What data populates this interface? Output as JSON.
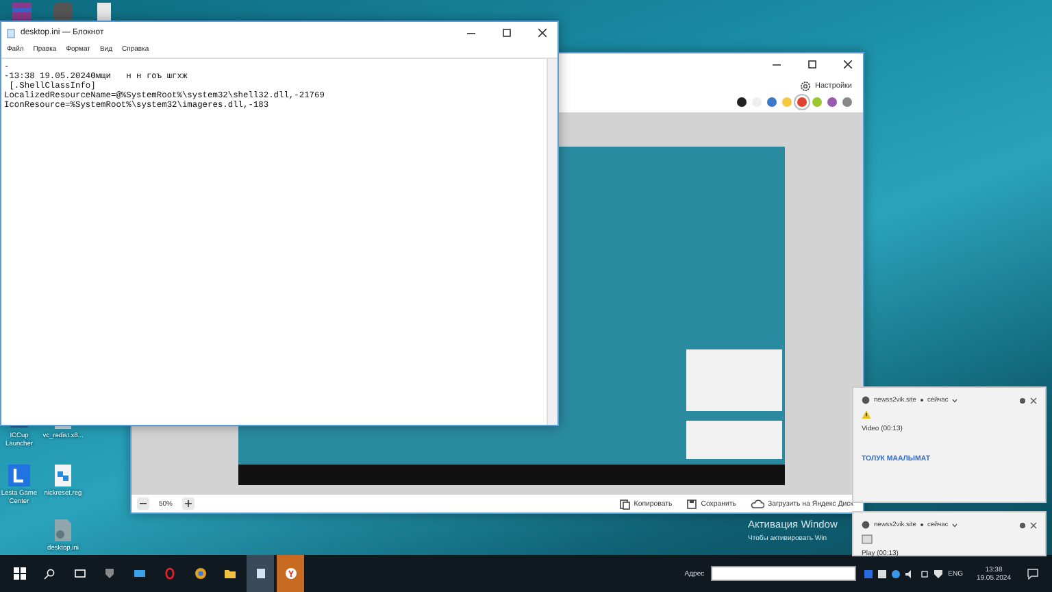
{
  "desktop": {
    "icons": [
      {
        "label": "ICCup Launcher",
        "kind": "app"
      },
      {
        "label": "vc_redist.x8...",
        "kind": "file"
      },
      {
        "label": "Lesta Game Center",
        "kind": "shortcut"
      },
      {
        "label": "nickreset.reg",
        "kind": "reg"
      },
      {
        "label": "desktop.ini",
        "kind": "ini"
      }
    ]
  },
  "notepad": {
    "title": "desktop.ini — Блокнот",
    "menu": [
      "Файл",
      "Правка",
      "Формат",
      "Вид",
      "Справка"
    ],
    "lines": [
      "-",
      "-13:38 19.05.2024Өмщи   н н гоъ шгхж",
      " [.ShellClassInfo]",
      "LocalizedResourceName=@%SystemRoot%\\system32\\shell32.dll,-21769",
      "IconResource=%SystemRoot%\\system32\\imageres.dll,-183"
    ]
  },
  "editor": {
    "settings": "Настройки",
    "colors": [
      {
        "color": "#222222",
        "selected": false
      },
      {
        "color": "#eeeeee",
        "selected": false
      },
      {
        "color": "#3a78c8",
        "selected": false
      },
      {
        "color": "#f5c842",
        "selected": false
      },
      {
        "color": "#e04030",
        "selected": true
      },
      {
        "color": "#9ac830",
        "selected": false
      },
      {
        "color": "#9a5ab0",
        "selected": false
      },
      {
        "color": "#888888",
        "selected": false
      }
    ],
    "zoom": "50%",
    "actions": [
      {
        "kind": "copy",
        "label": "Копировать"
      },
      {
        "kind": "save",
        "label": "Сохранить"
      },
      {
        "kind": "upload",
        "label": "Загрузить на Яндекс Диск"
      }
    ]
  },
  "activation": {
    "title": "Активация Window",
    "subtitle": "Чтобы активировать Win"
  },
  "notifications": [
    {
      "kind": "warning",
      "site": "newss2vik.site",
      "time": "сейчас",
      "message": "Video (00:13)",
      "link": "ТОЛУК МААЛЫМАТ"
    },
    {
      "kind": "image",
      "site": "newss2vik.site",
      "time": "сейчас",
      "message": "Play (00:13)"
    }
  ],
  "taskbar": {
    "address_label": "Адрес",
    "language": "ENG",
    "time": "13:38",
    "date": "19.05.2024"
  }
}
